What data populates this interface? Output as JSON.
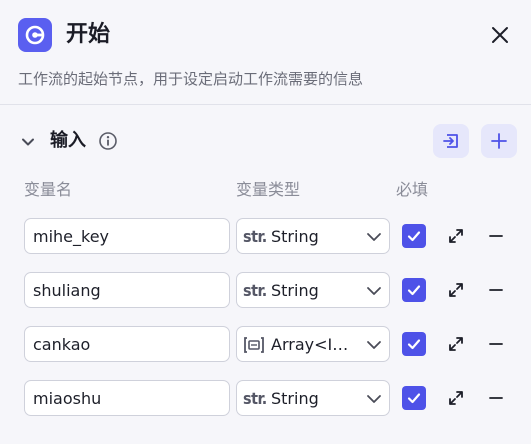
{
  "header": {
    "title": "开始",
    "description": "工作流的起始节点，用于设定启动工作流需要的信息"
  },
  "section": {
    "title": "输入"
  },
  "columns": {
    "name": "变量名",
    "type": "变量类型",
    "required": "必填"
  },
  "rows": [
    {
      "name": "mihe_key",
      "type_icon": "str.",
      "type": "String",
      "required": true
    },
    {
      "name": "shuliang",
      "type_icon": "str.",
      "type": "String",
      "required": true
    },
    {
      "name": "cankao",
      "type_icon": "array-icon",
      "type": "Array<I…",
      "required": true
    },
    {
      "name": "miaoshu",
      "type_icon": "str.",
      "type": "String",
      "required": true
    }
  ],
  "colors": {
    "accent": "#4e52e8",
    "accent_soft": "#e6e7fb",
    "background": "#f6f6fa"
  }
}
